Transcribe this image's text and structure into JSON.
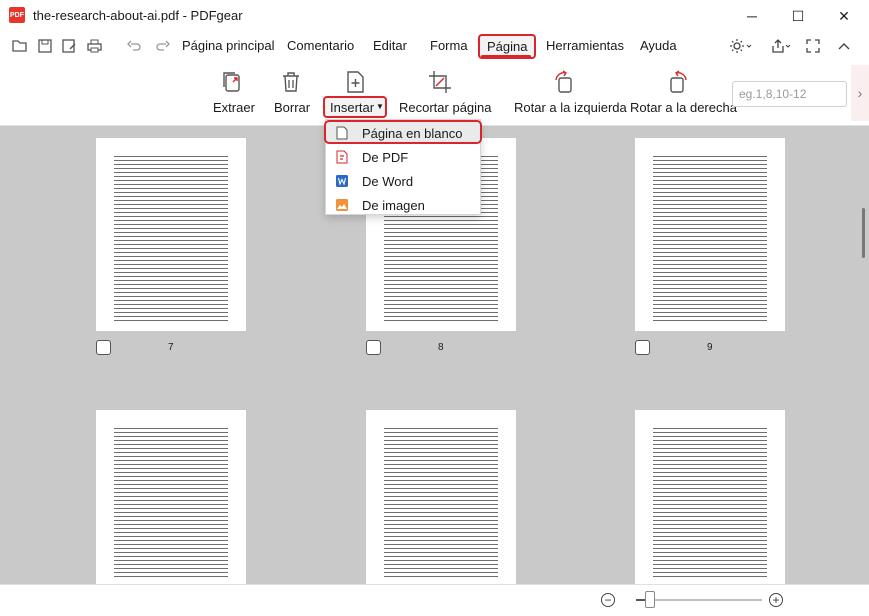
{
  "window": {
    "app_icon": "pdf-app-icon",
    "title": "the-research-about-ai.pdf - PDFgear",
    "minimize": "─",
    "maximize": "☐",
    "close": "✕"
  },
  "quick_access": [
    "folder-open-icon",
    "save-icon",
    "save-as-icon",
    "print-icon",
    "undo-icon",
    "redo-icon"
  ],
  "menu": {
    "items": [
      "Página principal",
      "Comentario",
      "Editar",
      "Forma",
      "Página",
      "Herramientas",
      "Ayuda"
    ],
    "active": "Página",
    "right_icons": [
      "brightness-icon",
      "share-icon",
      "fullscreen-icon",
      "collapse-ribbon-icon"
    ]
  },
  "ribbon": {
    "extract": "Extraer",
    "delete": "Borrar",
    "insert": "Insertar",
    "crop": "Recortar página",
    "rotate_left": "Rotar a la izquierda",
    "rotate_right": "Rotar a la derecha",
    "range_placeholder": "eg.1,8,10-12",
    "next": "›"
  },
  "insert_dropdown": {
    "items": [
      {
        "label": "Página en blanco",
        "icon": "blank-page-icon"
      },
      {
        "label": "De PDF",
        "icon": "pdf-file-icon"
      },
      {
        "label": "De Word",
        "icon": "word-file-icon"
      },
      {
        "label": "De imagen",
        "icon": "image-file-icon"
      }
    ]
  },
  "pages": [
    {
      "number": "7"
    },
    {
      "number": "8"
    },
    {
      "number": "9"
    }
  ],
  "zoom": {
    "minus": "−",
    "plus": "+",
    "level": 0.11
  },
  "colors": {
    "accent": "#d8262c",
    "canvas": "#c9c9c9"
  }
}
